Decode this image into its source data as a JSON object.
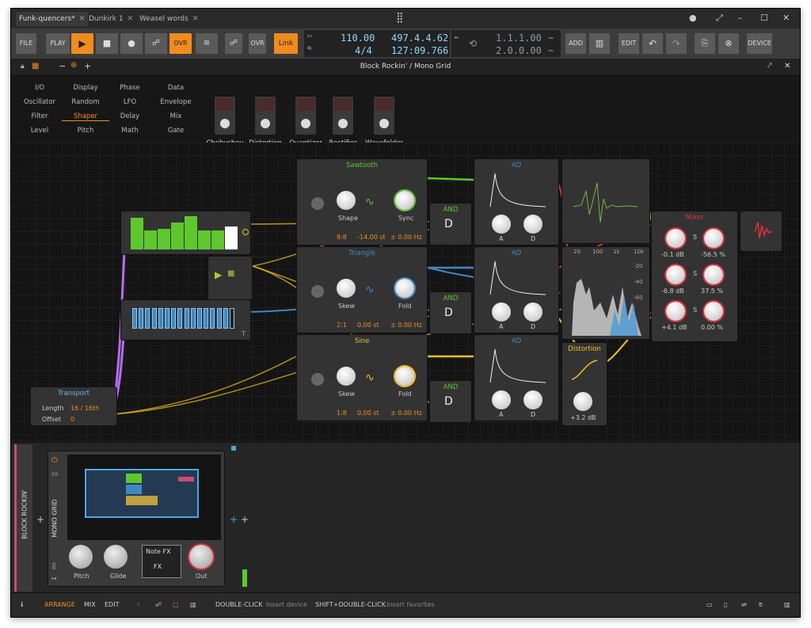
{
  "tabs": [
    {
      "label": "Funk-quencers*"
    },
    {
      "label": "Dunkirk 1"
    },
    {
      "label": "Weasel words"
    }
  ],
  "transport": {
    "file": "FILE",
    "play": "PLAY",
    "ovr": "OVR",
    "link": "Link",
    "tempo": "110.00",
    "sig": "4/4",
    "pos_bars": "497.4.4.62",
    "pos_time": "127:09.766",
    "loop_start": "1.1.1.00",
    "loop_end": "2.0.0.00",
    "add": "ADD",
    "edit": "EDIT",
    "device": "DEVICE",
    "ovr2": "OVR"
  },
  "device": {
    "title": "Block Rockin' / Mono Grid"
  },
  "categories": [
    [
      "I/O",
      "Display",
      "Phase",
      "Data"
    ],
    [
      "Oscillator",
      "Random",
      "LFO",
      "Envelope"
    ],
    [
      "Filter",
      "Shaper",
      "Delay",
      "Mix"
    ],
    [
      "Level",
      "Pitch",
      "Math",
      "Gate"
    ]
  ],
  "shapers": [
    {
      "label": "Chebyshev"
    },
    {
      "label": "Distortion"
    },
    {
      "label": "Quantizer"
    },
    {
      "label": "Rectifier"
    },
    {
      "label": "Wavefolder"
    }
  ],
  "modules": {
    "saw": {
      "title": "Sawtooth",
      "k1": "Shape",
      "k2": "Sync",
      "ratio": "9:8",
      "st": "-14.00 st",
      "hz": "± 0.00 Hz"
    },
    "tri": {
      "title": "Triangle",
      "k1": "Skew",
      "k2": "Fold",
      "ratio": "2:1",
      "st": "0.00 st",
      "hz": "± 0.00 Hz"
    },
    "sine": {
      "title": "Sine",
      "k1": "Skew",
      "k2": "Fold",
      "ratio": "1:8",
      "st": "0.00 st",
      "hz": "± 0.00 Hz"
    },
    "and": "AND",
    "ad": "AD",
    "a": "A",
    "d": "D",
    "dist": {
      "title": "Distortion",
      "val": "+3.2 dB"
    },
    "mixer": {
      "title": "Mixer",
      "r1a": "-0.1 dB",
      "r1b": "-56.5 %",
      "r2a": "-6.8 dB",
      "r2b": "37.5 %",
      "r3a": "+4.1 dB",
      "r3b": "0.00 %",
      "s": "S"
    },
    "transport": {
      "title": "Transport",
      "len_l": "Length",
      "len_v": "16 / 16th",
      "off_l": "Offset",
      "off_v": "0"
    },
    "T": "T",
    "spec": [
      "20",
      "100",
      "1k",
      "10k",
      "-20",
      "-40",
      "-60"
    ]
  },
  "lower": {
    "track": "BLOCK ROCKIN'",
    "grid": "MONO GRID",
    "pitch": "Pitch",
    "glide": "Glide",
    "out": "Out",
    "notefx": "Note FX",
    "fx": "FX"
  },
  "status": {
    "arrange": "ARRANGE",
    "mix": "MIX",
    "edit": "EDIT",
    "dc": "DOUBLE-CLICK",
    "dc_d": "Insert device",
    "sdc": "SHIFT+DOUBLE-CLICK",
    "sdc_d": "Insert favorites"
  },
  "colors": {
    "accent": "#f08c1e",
    "lcd": "#8fd6ff",
    "green": "#5ec72e",
    "blue": "#3f88c5",
    "purple": "#b56cf0",
    "yellow": "#f0c020",
    "red": "#e0303a"
  }
}
